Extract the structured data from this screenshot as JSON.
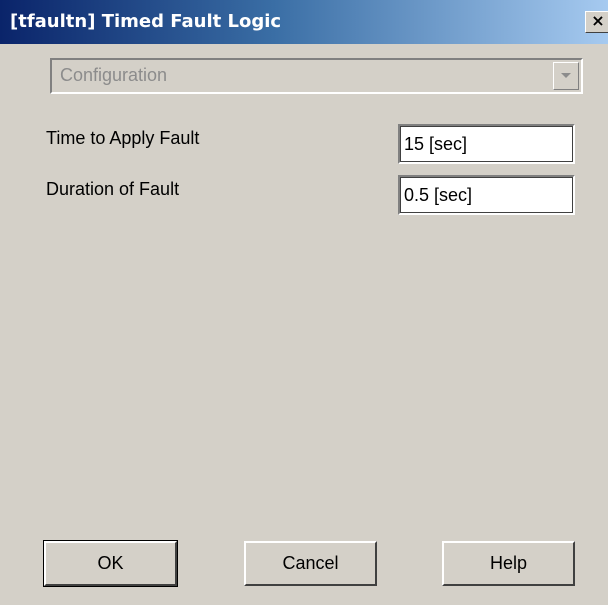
{
  "window": {
    "title": "[tfaultn] Timed Fault Logic",
    "close_label": "×"
  },
  "config": {
    "selected": "Configuration"
  },
  "fields": [
    {
      "label": "Time to Apply Fault",
      "value": "15 [sec]"
    },
    {
      "label": "Duration of Fault",
      "value": "0.5 [sec]"
    }
  ],
  "buttons": {
    "ok": "OK",
    "cancel": "Cancel",
    "help": "Help"
  },
  "icons": {
    "close": "close-icon",
    "dropdown": "chevron-down-icon"
  },
  "colors": {
    "title_gradient_start": "#0a246a",
    "title_gradient_end": "#a6caf0",
    "dialog_background": "#d4d0c8"
  }
}
